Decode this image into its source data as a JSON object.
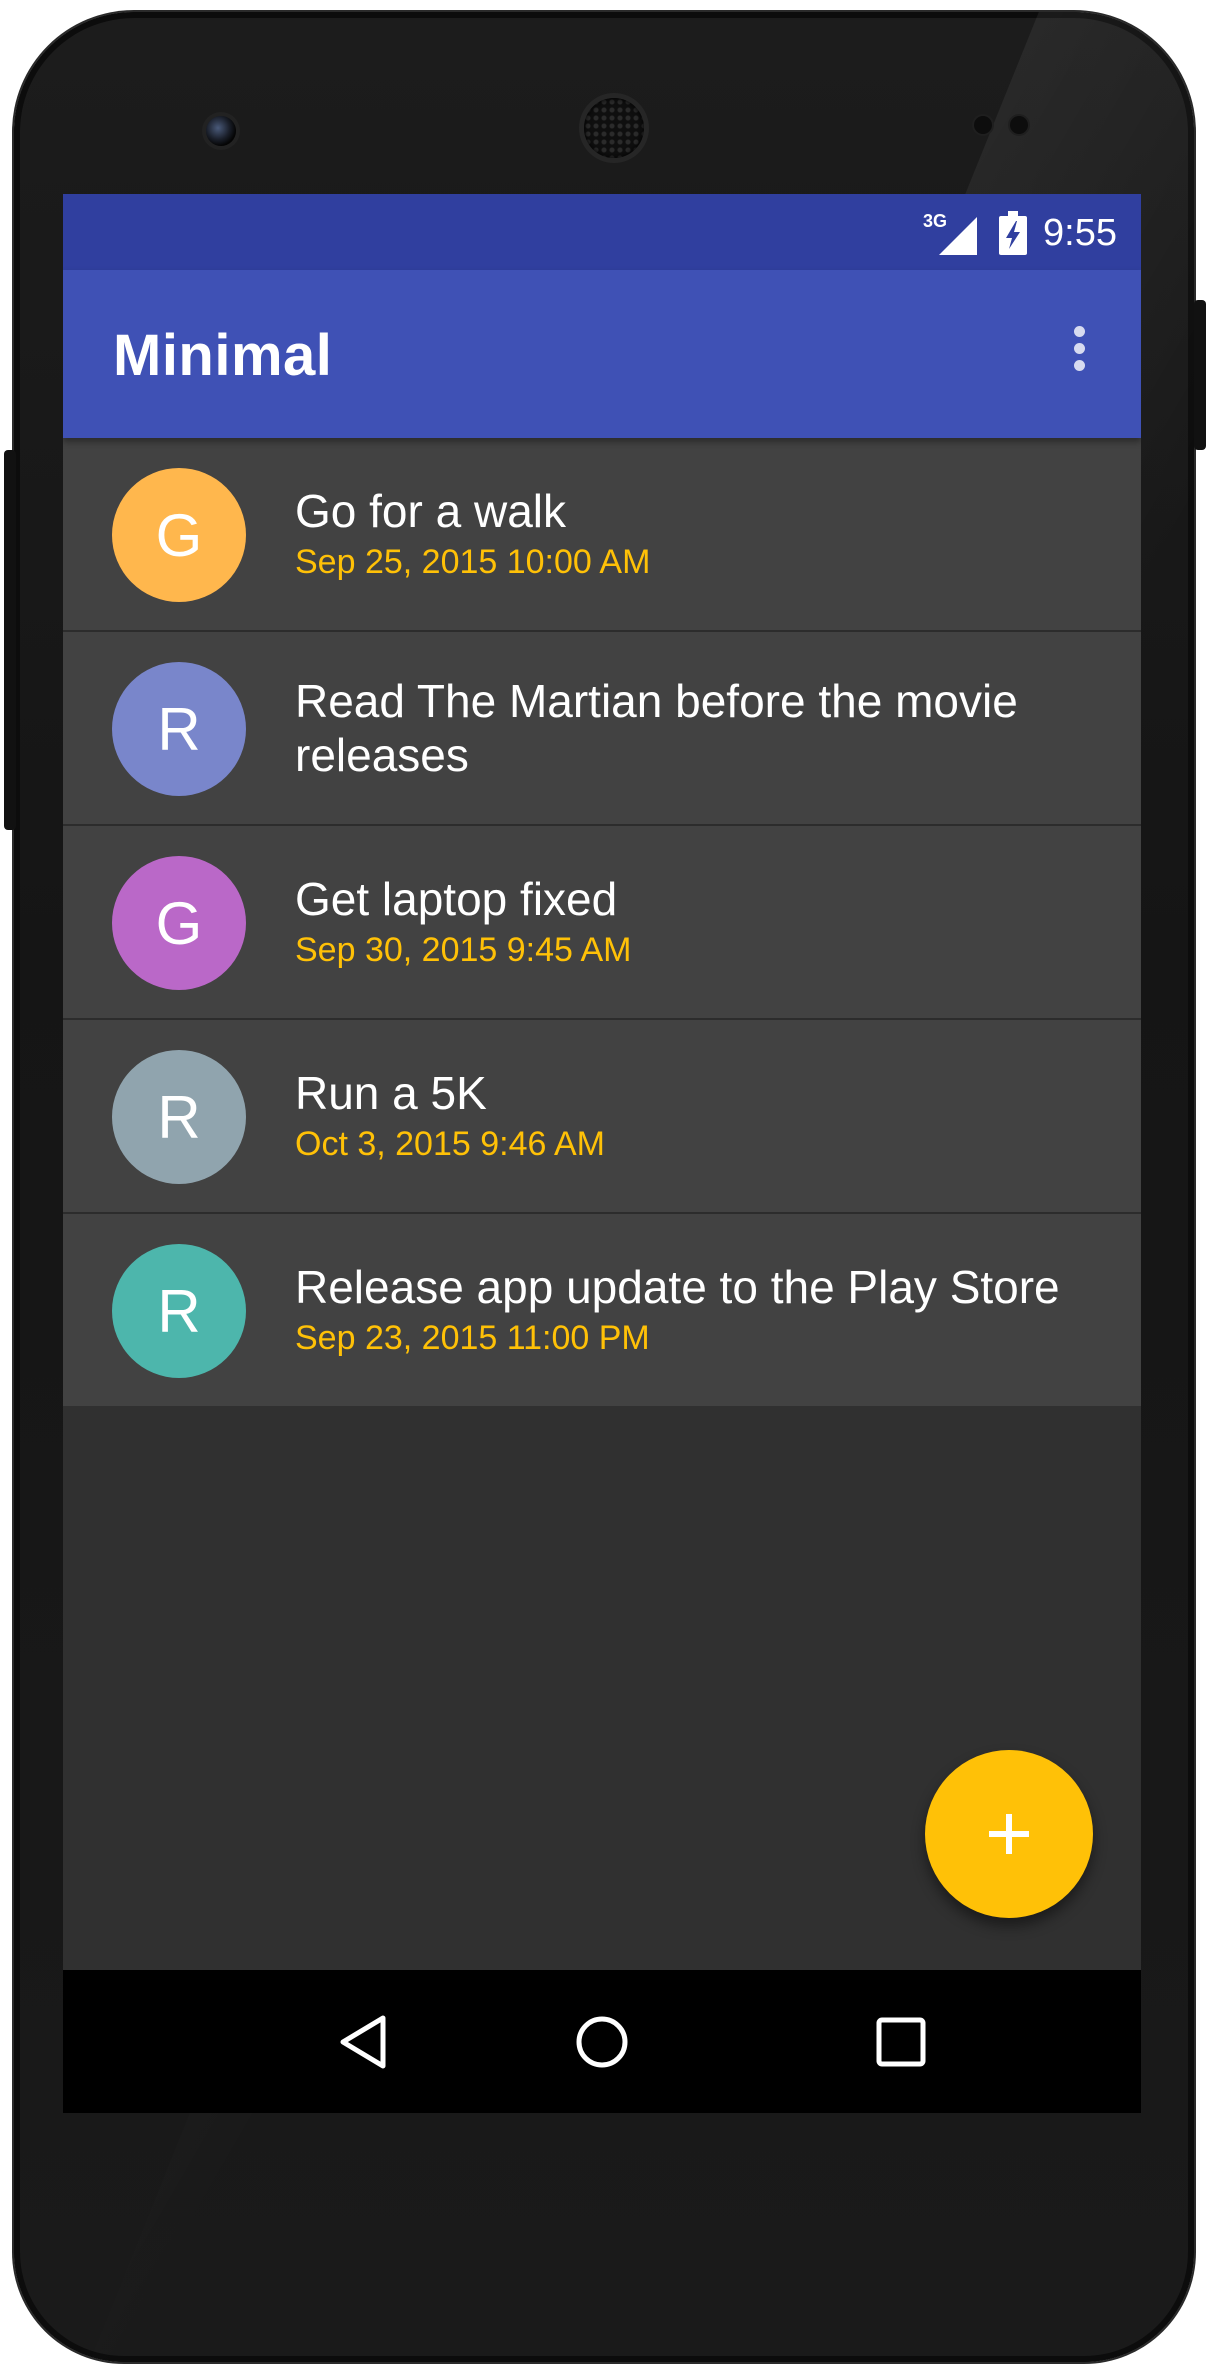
{
  "status_bar": {
    "network_type": "3G",
    "time": "9:55",
    "icons": [
      "signal-icon",
      "battery-charging-icon"
    ]
  },
  "app_bar": {
    "title": "Minimal",
    "menu_icon": "overflow-menu-icon"
  },
  "tasks": [
    {
      "initial": "G",
      "title": "Go for a walk",
      "date": "Sep 25, 2015  10:00 AM",
      "avatar_color": "#ffb74d"
    },
    {
      "initial": "R",
      "title": "Read The Martian before the movie releases",
      "date": "",
      "avatar_color": "#7986cb"
    },
    {
      "initial": "G",
      "title": "Get laptop fixed",
      "date": "Sep 30, 2015  9:45 AM",
      "avatar_color": "#ba68c8"
    },
    {
      "initial": "R",
      "title": "Run a 5K",
      "date": "Oct 3, 2015  9:46 AM",
      "avatar_color": "#90a4ae"
    },
    {
      "initial": "R",
      "title": "Release app update to the Play Store",
      "date": "Sep 23, 2015  11:00 PM",
      "avatar_color": "#4db6ac"
    }
  ],
  "fab": {
    "icon": "plus-icon",
    "color": "#ffc107"
  },
  "nav_bar": {
    "icons": [
      "back-icon",
      "home-icon",
      "recents-icon"
    ]
  },
  "theme": {
    "primary": "#3f51b5",
    "primary_dark": "#303f9f",
    "accent": "#ffc107",
    "background": "#303030",
    "row": "#424242"
  }
}
